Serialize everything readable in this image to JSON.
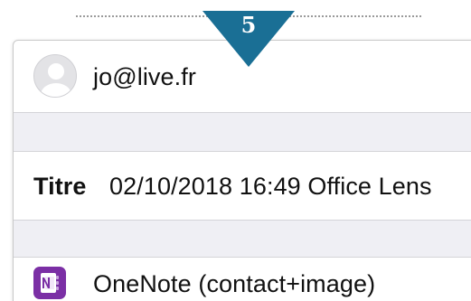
{
  "step": {
    "number": "5"
  },
  "account": {
    "email": "jo@live.fr",
    "icon": "user-avatar-icon"
  },
  "title_field": {
    "label": "Titre",
    "value": "02/10/2018 16:49 Office Lens"
  },
  "destination": {
    "label": "OneNote (contact+image)",
    "icon": "onenote-icon"
  },
  "colors": {
    "badge": "#1a6f95",
    "onenote": "#7b2fa5",
    "group_separator": "#efeff4"
  }
}
